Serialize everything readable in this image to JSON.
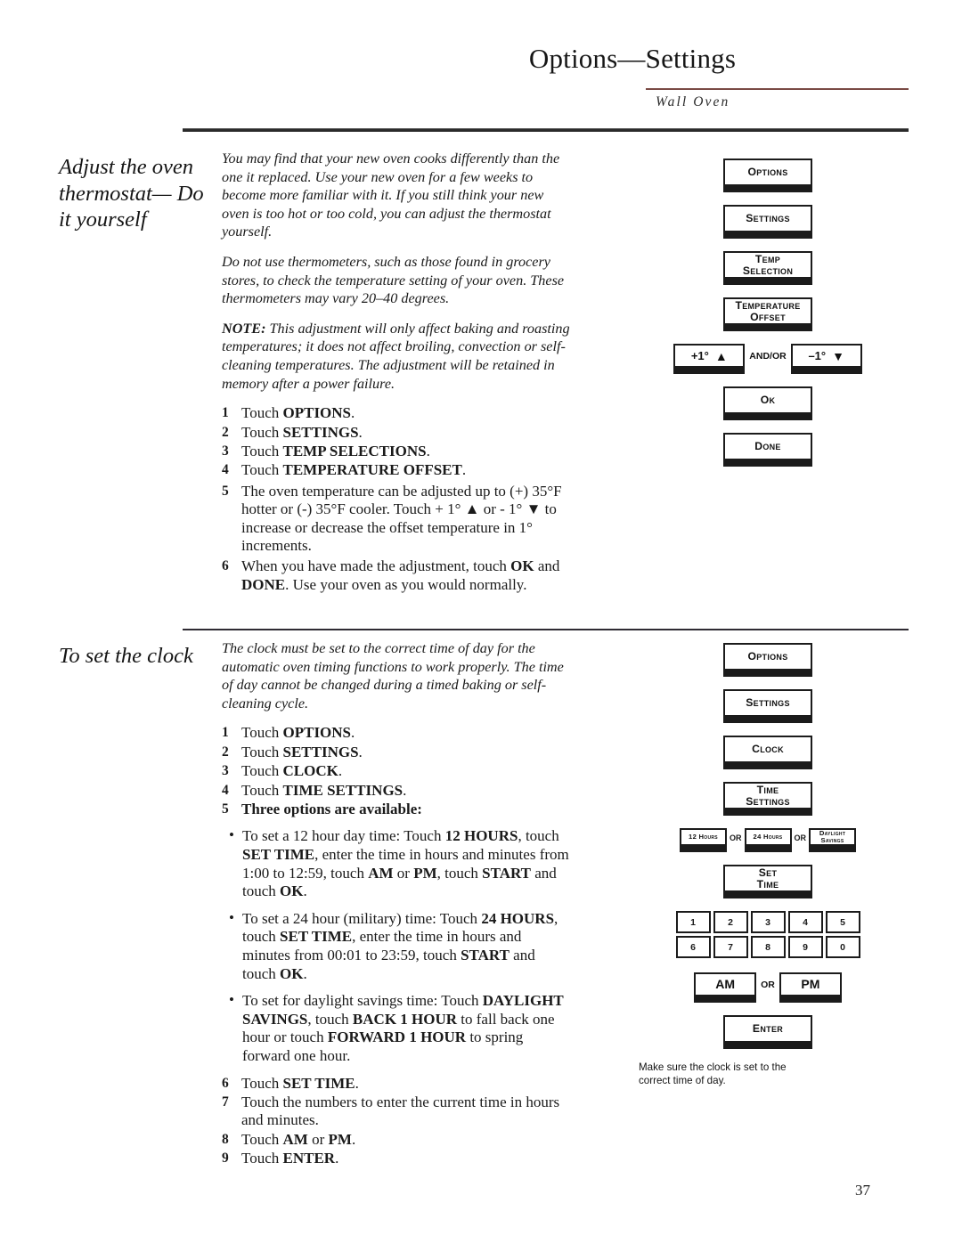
{
  "header": {
    "title": "Options—Settings",
    "subtitle": "Wall Oven",
    "rule_color": "#7a4a45"
  },
  "page_number": "37",
  "sections": [
    {
      "id": "thermostat",
      "heading": "Adjust the oven thermostat— Do it yourself",
      "intro": [
        "You may find that your new oven cooks differently than the one it replaced. Use your new oven for a few weeks to become more familiar with it. If you still think your new oven is too hot or too cold, you can adjust the thermostat yourself.",
        "Do not use thermometers, such as those found in grocery stores, to check the temperature setting of your oven. These thermometers may vary 20–40 degrees."
      ],
      "note_label": "NOTE:",
      "note_text": " This adjustment will only affect baking and roasting temperatures; it does not affect broiling, convection or self-cleaning temperatures. The adjustment will be retained in memory after a power failure.",
      "steps": [
        {
          "num": "1",
          "pre": "Touch ",
          "bold": "OPTIONS",
          "post": "."
        },
        {
          "num": "2",
          "pre": "Touch ",
          "bold": "SETTINGS",
          "post": "."
        },
        {
          "num": "3",
          "pre": "Touch ",
          "bold": "TEMP SELECTIONS",
          "post": "."
        },
        {
          "num": "4",
          "pre": "Touch ",
          "bold": "TEMPERATURE OFFSET",
          "post": "."
        },
        {
          "num": "5",
          "pre": "The oven temperature can be adjusted up to (+) 35°F hotter or (-) 35°F cooler. Touch + 1° ▲ or - 1° ▼ to increase or decrease the offset temperature in 1° increments.",
          "bold": "",
          "post": ""
        },
        {
          "num": "6",
          "pre": "When you have made the adjustment, touch ",
          "bold": "OK",
          "mid": " and ",
          "bold2": "DONE",
          "post": ". Use your oven as you would normally."
        }
      ],
      "diagram": {
        "buttons": [
          {
            "label": "Options",
            "lines": [
              "Options"
            ]
          },
          {
            "label": "Settings",
            "lines": [
              "Settings"
            ]
          },
          {
            "label": "Temp Selection",
            "lines": [
              "Temp",
              "Selection"
            ]
          },
          {
            "label": "Temperature Offset",
            "lines": [
              "Temperature",
              "Offset"
            ]
          }
        ],
        "arrow_row": {
          "left_label": "+1°",
          "left_arrow": "▲",
          "conjunction": "AND/OR",
          "right_label": "–1°",
          "right_arrow": "▼"
        },
        "buttons_after": [
          {
            "label": "Ok",
            "lines": [
              "Ok"
            ]
          },
          {
            "label": "Done",
            "lines": [
              "Done"
            ]
          }
        ]
      }
    },
    {
      "id": "clock",
      "heading": "To set the clock",
      "intro": [
        "The clock must be set to the correct time of day for the automatic oven timing functions to work properly. The time of day cannot be changed during a timed baking or self-cleaning cycle."
      ],
      "steps": [
        {
          "num": "1",
          "pre": "Touch ",
          "bold": "OPTIONS",
          "post": "."
        },
        {
          "num": "2",
          "pre": "Touch ",
          "bold": "SETTINGS",
          "post": "."
        },
        {
          "num": "3",
          "pre": "Touch ",
          "bold": "CLOCK",
          "post": "."
        },
        {
          "num": "4",
          "pre": "Touch ",
          "bold": "TIME SETTINGS",
          "post": "."
        },
        {
          "num": "5",
          "pre": "",
          "bold": "Three options are available:",
          "post": ""
        }
      ],
      "bullets": [
        "To set a 12 hour day time: Touch <b>12 HOURS</b>, touch <b>SET TIME</b>, enter the time in hours and minutes from 1:00 to 12:59, touch <b>AM</b> or <b>PM</b>, touch <b>START</b> and touch <b>OK</b>.",
        "To set a 24 hour (military) time: Touch <b>24 HOURS</b>, touch <b>SET TIME</b>, enter the time in hours and minutes from 00:01 to 23:59, touch <b>START</b> and touch <b>OK</b>.",
        "To set for daylight savings time: Touch <b>DAYLIGHT SAVINGS</b>, touch <b>BACK 1 HOUR</b> to fall back one hour or touch <b>FORWARD 1 HOUR</b> to spring forward one hour."
      ],
      "steps_after": [
        {
          "num": "6",
          "pre": "Touch ",
          "bold": "SET TIME",
          "post": "."
        },
        {
          "num": "7",
          "pre": "Touch the numbers to enter the current time in hours and minutes.",
          "bold": "",
          "post": ""
        },
        {
          "num": "8",
          "pre": "Touch ",
          "bold": "AM",
          "mid": " or ",
          "bold2": "PM",
          "post": "."
        },
        {
          "num": "9",
          "pre": "Touch ",
          "bold": "ENTER",
          "post": "."
        }
      ],
      "diagram": {
        "buttons": [
          {
            "label": "Options",
            "lines": [
              "Options"
            ]
          },
          {
            "label": "Settings",
            "lines": [
              "Settings"
            ]
          },
          {
            "label": "Clock",
            "lines": [
              "Clock"
            ]
          },
          {
            "label": "Time Settings",
            "lines": [
              "Time",
              "Settings"
            ]
          }
        ],
        "mode_row": {
          "option1": "12 Hours",
          "conj1": "OR",
          "option2": "24 Hours",
          "conj2": "OR",
          "option3_lines": [
            "Daylight",
            "Savings"
          ]
        },
        "set_time": {
          "lines": [
            "Set",
            "Time"
          ]
        },
        "keypad": {
          "row1": [
            "1",
            "2",
            "3",
            "4",
            "5"
          ],
          "row2": [
            "6",
            "7",
            "8",
            "9",
            "0"
          ]
        },
        "ampm_row": {
          "am": "AM",
          "conjunction": "OR",
          "pm": "PM"
        },
        "enter": "Enter",
        "caption": "Make sure the clock is set to the correct time of day."
      }
    }
  ]
}
